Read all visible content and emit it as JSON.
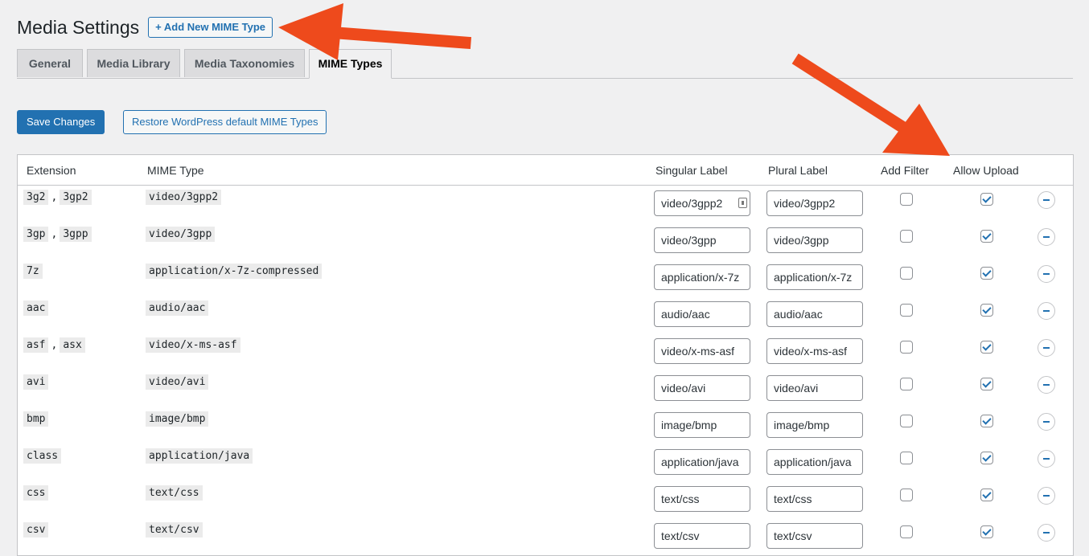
{
  "header": {
    "title": "Media Settings",
    "add_new_label": "+ Add New MIME Type"
  },
  "tabs": [
    {
      "label": "General",
      "active": false
    },
    {
      "label": "Media Library",
      "active": false
    },
    {
      "label": "Media Taxonomies",
      "active": false
    },
    {
      "label": "MIME Types",
      "active": true
    }
  ],
  "actions": {
    "save_label": "Save Changes",
    "restore_label": "Restore WordPress default MIME Types"
  },
  "table": {
    "columns": [
      "Extension",
      "MIME Type",
      "Singular Label",
      "Plural Label",
      "Add Filter",
      "Allow Upload"
    ],
    "rows": [
      {
        "extensions": [
          "3g2",
          "3gp2"
        ],
        "mime": "video/3gpp2",
        "singular": "video/3gpp2",
        "plural": "video/3gpp2",
        "add_filter": false,
        "allow_upload": true
      },
      {
        "extensions": [
          "3gp",
          "3gpp"
        ],
        "mime": "video/3gpp",
        "singular": "video/3gpp",
        "plural": "video/3gpp",
        "add_filter": false,
        "allow_upload": true
      },
      {
        "extensions": [
          "7z"
        ],
        "mime": "application/x-7z-compressed",
        "singular": "application/x-7z",
        "plural": "application/x-7z",
        "add_filter": false,
        "allow_upload": true
      },
      {
        "extensions": [
          "aac"
        ],
        "mime": "audio/aac",
        "singular": "audio/aac",
        "plural": "audio/aac",
        "add_filter": false,
        "allow_upload": true
      },
      {
        "extensions": [
          "asf",
          "asx"
        ],
        "mime": "video/x-ms-asf",
        "singular": "video/x-ms-asf",
        "plural": "video/x-ms-asf",
        "add_filter": false,
        "allow_upload": true
      },
      {
        "extensions": [
          "avi"
        ],
        "mime": "video/avi",
        "singular": "video/avi",
        "plural": "video/avi",
        "add_filter": false,
        "allow_upload": true
      },
      {
        "extensions": [
          "bmp"
        ],
        "mime": "image/bmp",
        "singular": "image/bmp",
        "plural": "image/bmp",
        "add_filter": false,
        "allow_upload": true
      },
      {
        "extensions": [
          "class"
        ],
        "mime": "application/java",
        "singular": "application/java",
        "plural": "application/java",
        "add_filter": false,
        "allow_upload": true
      },
      {
        "extensions": [
          "css"
        ],
        "mime": "text/css",
        "singular": "text/css",
        "plural": "text/css",
        "add_filter": false,
        "allow_upload": true
      },
      {
        "extensions": [
          "csv"
        ],
        "mime": "text/csv",
        "singular": "text/csv",
        "plural": "text/csv",
        "add_filter": false,
        "allow_upload": true
      }
    ]
  },
  "colors": {
    "accent": "#2271b1",
    "annotation_arrow": "#ee4a1c"
  },
  "icons": {
    "row_remove": "minus-circle-icon",
    "first_singular_field": "lock-icon"
  }
}
